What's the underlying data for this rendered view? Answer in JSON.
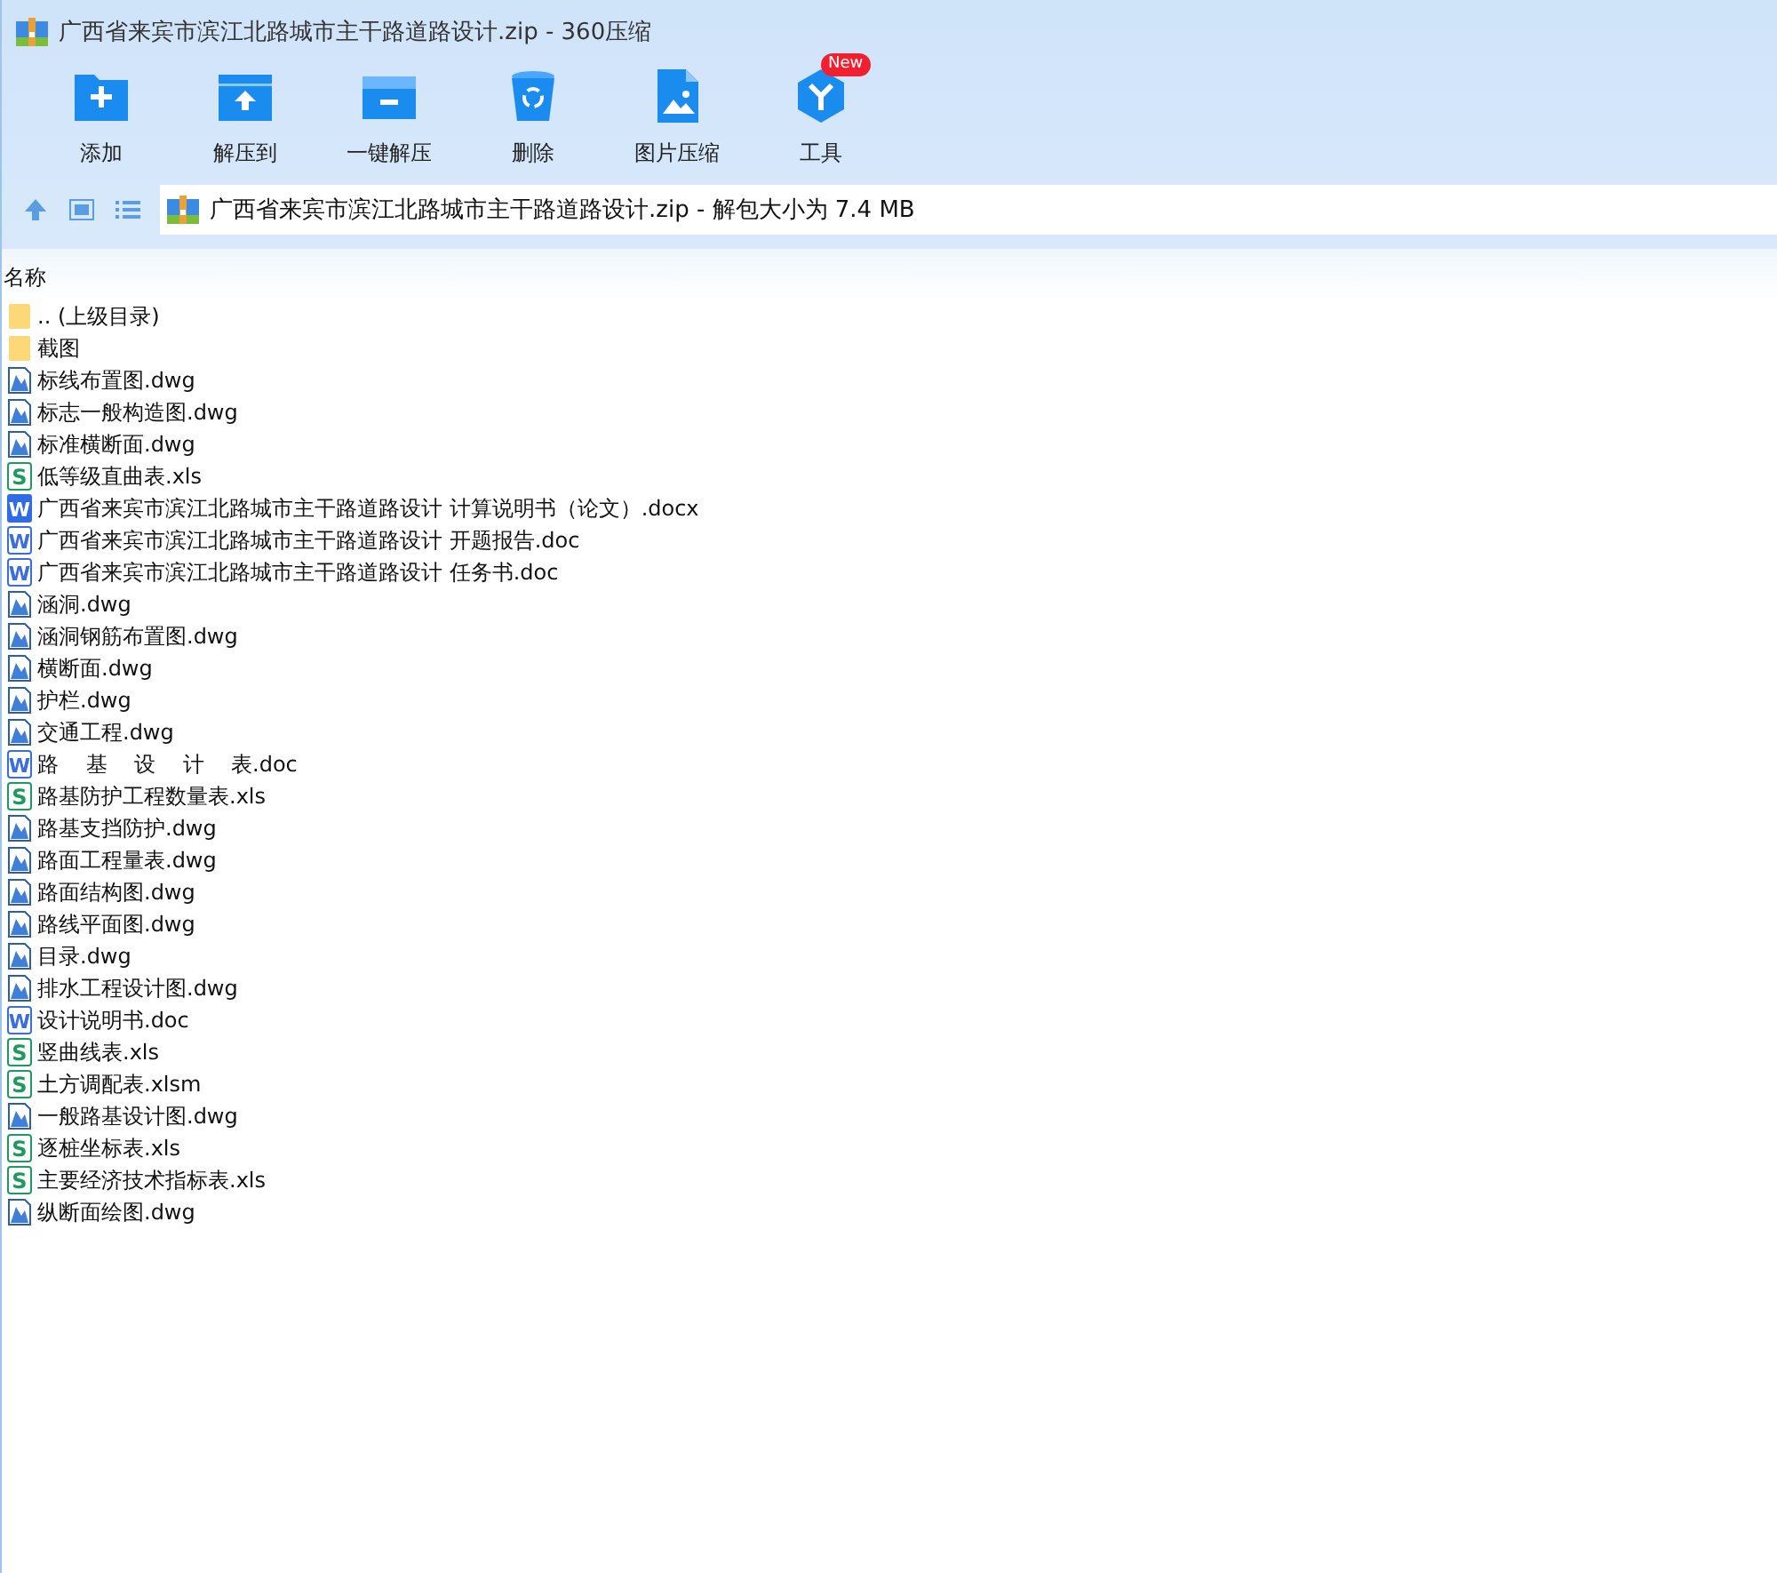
{
  "window": {
    "title": "广西省来宾市滨江北路城市主干路道路设计.zip - 360压缩"
  },
  "toolbar": [
    {
      "label": "添加",
      "kind": "add"
    },
    {
      "label": "解压到",
      "kind": "extract"
    },
    {
      "label": "一键解压",
      "kind": "oneclick"
    },
    {
      "label": "删除",
      "kind": "delete"
    },
    {
      "label": "图片压缩",
      "kind": "image"
    },
    {
      "label": "工具",
      "kind": "tools",
      "badge": "New"
    }
  ],
  "address": {
    "path": "广西省来宾市滨江北路城市主干路道路设计.zip - 解包大小为 7.4 MB"
  },
  "table": {
    "columns": [
      "名称"
    ],
    "rows": [
      {
        "name": ".. (上级目录)",
        "kind": "folder"
      },
      {
        "name": "截图",
        "kind": "folder"
      },
      {
        "name": "标线布置图.dwg",
        "kind": "dwg"
      },
      {
        "name": "标志一般构造图.dwg",
        "kind": "dwg"
      },
      {
        "name": "标准横断面.dwg",
        "kind": "dwg"
      },
      {
        "name": "低等级直曲表.xls",
        "kind": "xls",
        "icon": "S"
      },
      {
        "name": "广西省来宾市滨江北路城市主干路道路设计 计算说明书（论文）.docx",
        "kind": "docx",
        "icon": "W"
      },
      {
        "name": "广西省来宾市滨江北路城市主干路道路设计 开题报告.doc",
        "kind": "doc",
        "icon": "W"
      },
      {
        "name": "广西省来宾市滨江北路城市主干路道路设计 任务书.doc",
        "kind": "doc",
        "icon": "W"
      },
      {
        "name": "涵洞.dwg",
        "kind": "dwg"
      },
      {
        "name": "涵洞钢筋布置图.dwg",
        "kind": "dwg"
      },
      {
        "name": "横断面.dwg",
        "kind": "dwg"
      },
      {
        "name": "护栏.dwg",
        "kind": "dwg"
      },
      {
        "name": "交通工程.dwg",
        "kind": "dwg"
      },
      {
        "name": "路    基    设    计    表.doc",
        "kind": "doc",
        "icon": "W"
      },
      {
        "name": "路基防护工程数量表.xls",
        "kind": "xls",
        "icon": "S"
      },
      {
        "name": "路基支挡防护.dwg",
        "kind": "dwg"
      },
      {
        "name": "路面工程量表.dwg",
        "kind": "dwg"
      },
      {
        "name": "路面结构图.dwg",
        "kind": "dwg"
      },
      {
        "name": "路线平面图.dwg",
        "kind": "dwg"
      },
      {
        "name": "目录.dwg",
        "kind": "dwg"
      },
      {
        "name": "排水工程设计图.dwg",
        "kind": "dwg"
      },
      {
        "name": "设计说明书.doc",
        "kind": "doc",
        "icon": "W"
      },
      {
        "name": "竖曲线表.xls",
        "kind": "xls",
        "icon": "S"
      },
      {
        "name": "土方调配表.xlsm",
        "kind": "xls",
        "icon": "S"
      },
      {
        "name": "一般路基设计图.dwg",
        "kind": "dwg"
      },
      {
        "name": "逐桩坐标表.xls",
        "kind": "xls",
        "icon": "S"
      },
      {
        "name": "主要经济技术指标表.xls",
        "kind": "xls",
        "icon": "S"
      },
      {
        "name": "纵断面绘图.dwg",
        "kind": "dwg"
      }
    ]
  }
}
